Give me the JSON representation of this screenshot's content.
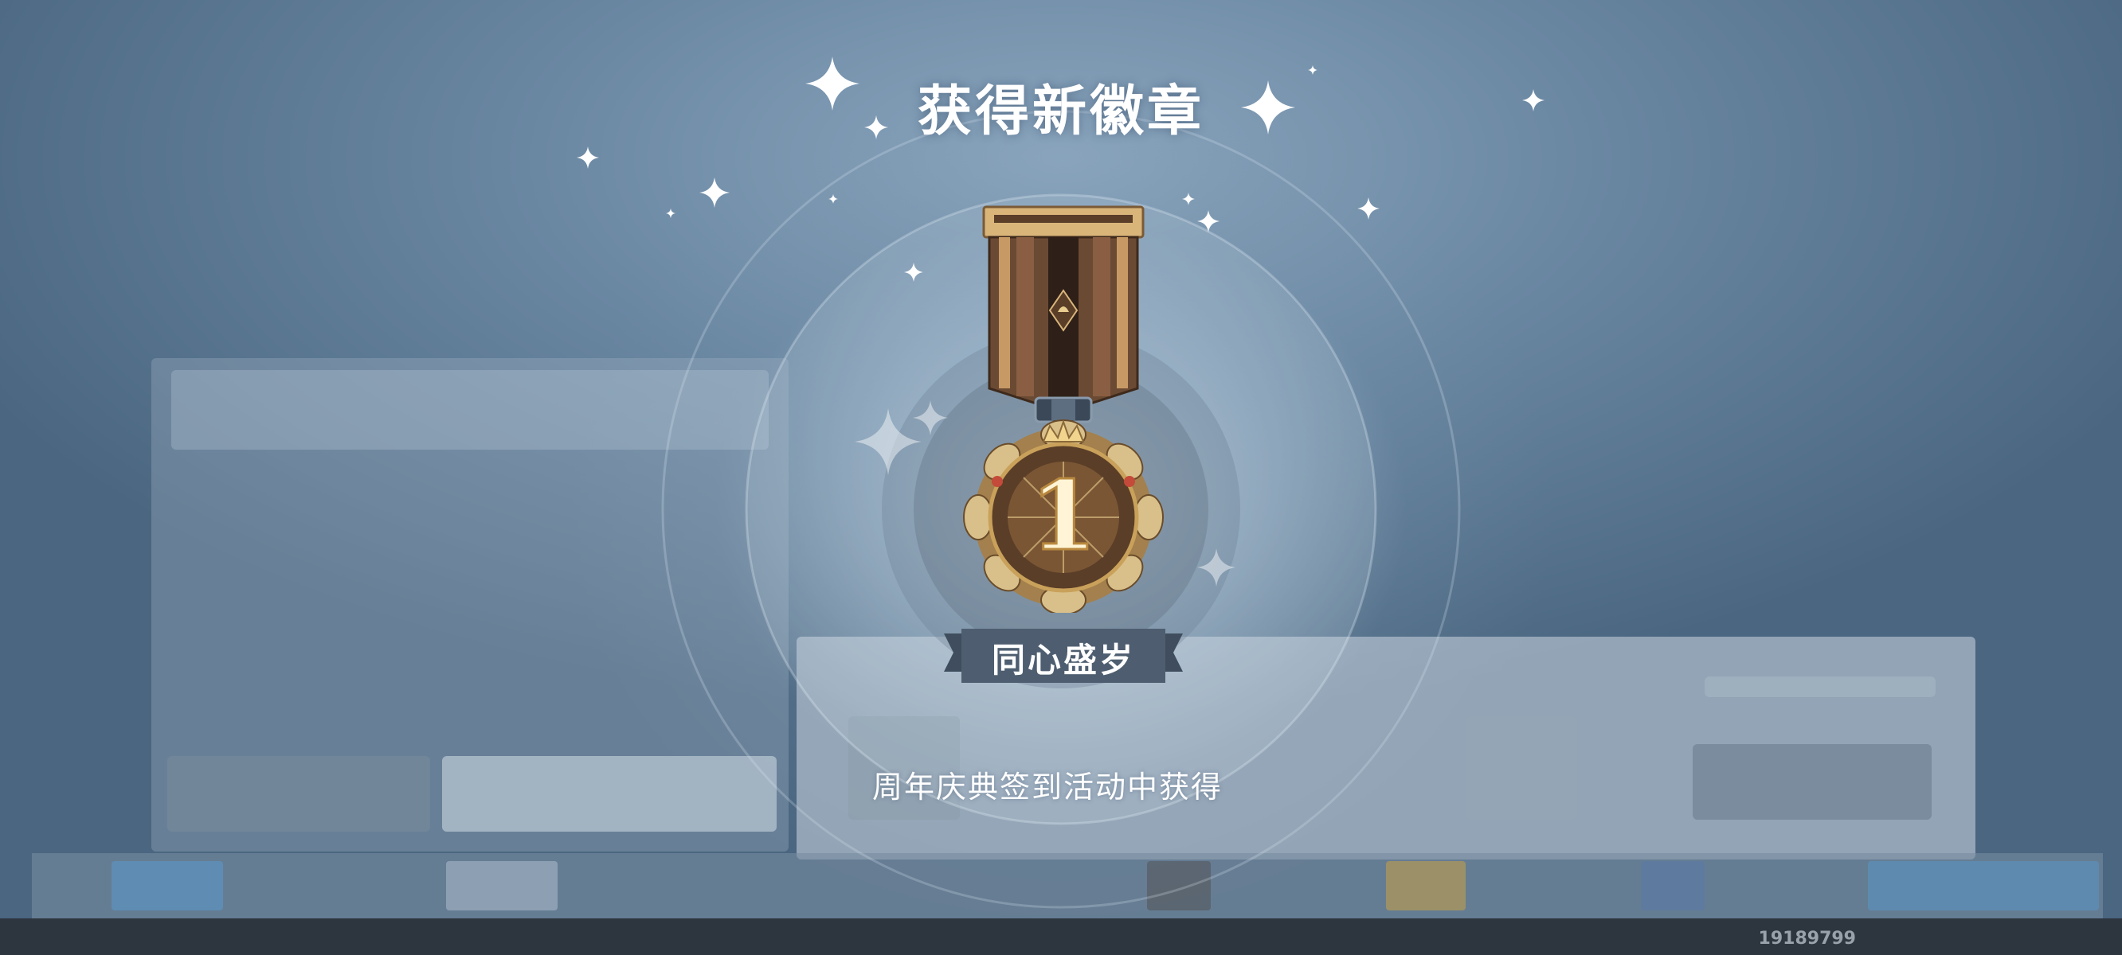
{
  "popup": {
    "title": "获得新徽章",
    "badge_name": "同心盛岁",
    "description": "周年庆典签到活动中获得",
    "medal_number": "1"
  },
  "footer": {
    "uid": "19189799"
  },
  "icons": {
    "medal": "medal-icon",
    "sparkle": "sparkle-icon"
  },
  "colors": {
    "title_text": "#ffffff",
    "ribbon_brown": "#6b4a34",
    "medal_gold": "#c9a15a",
    "name_banner": "#4e5e70"
  }
}
